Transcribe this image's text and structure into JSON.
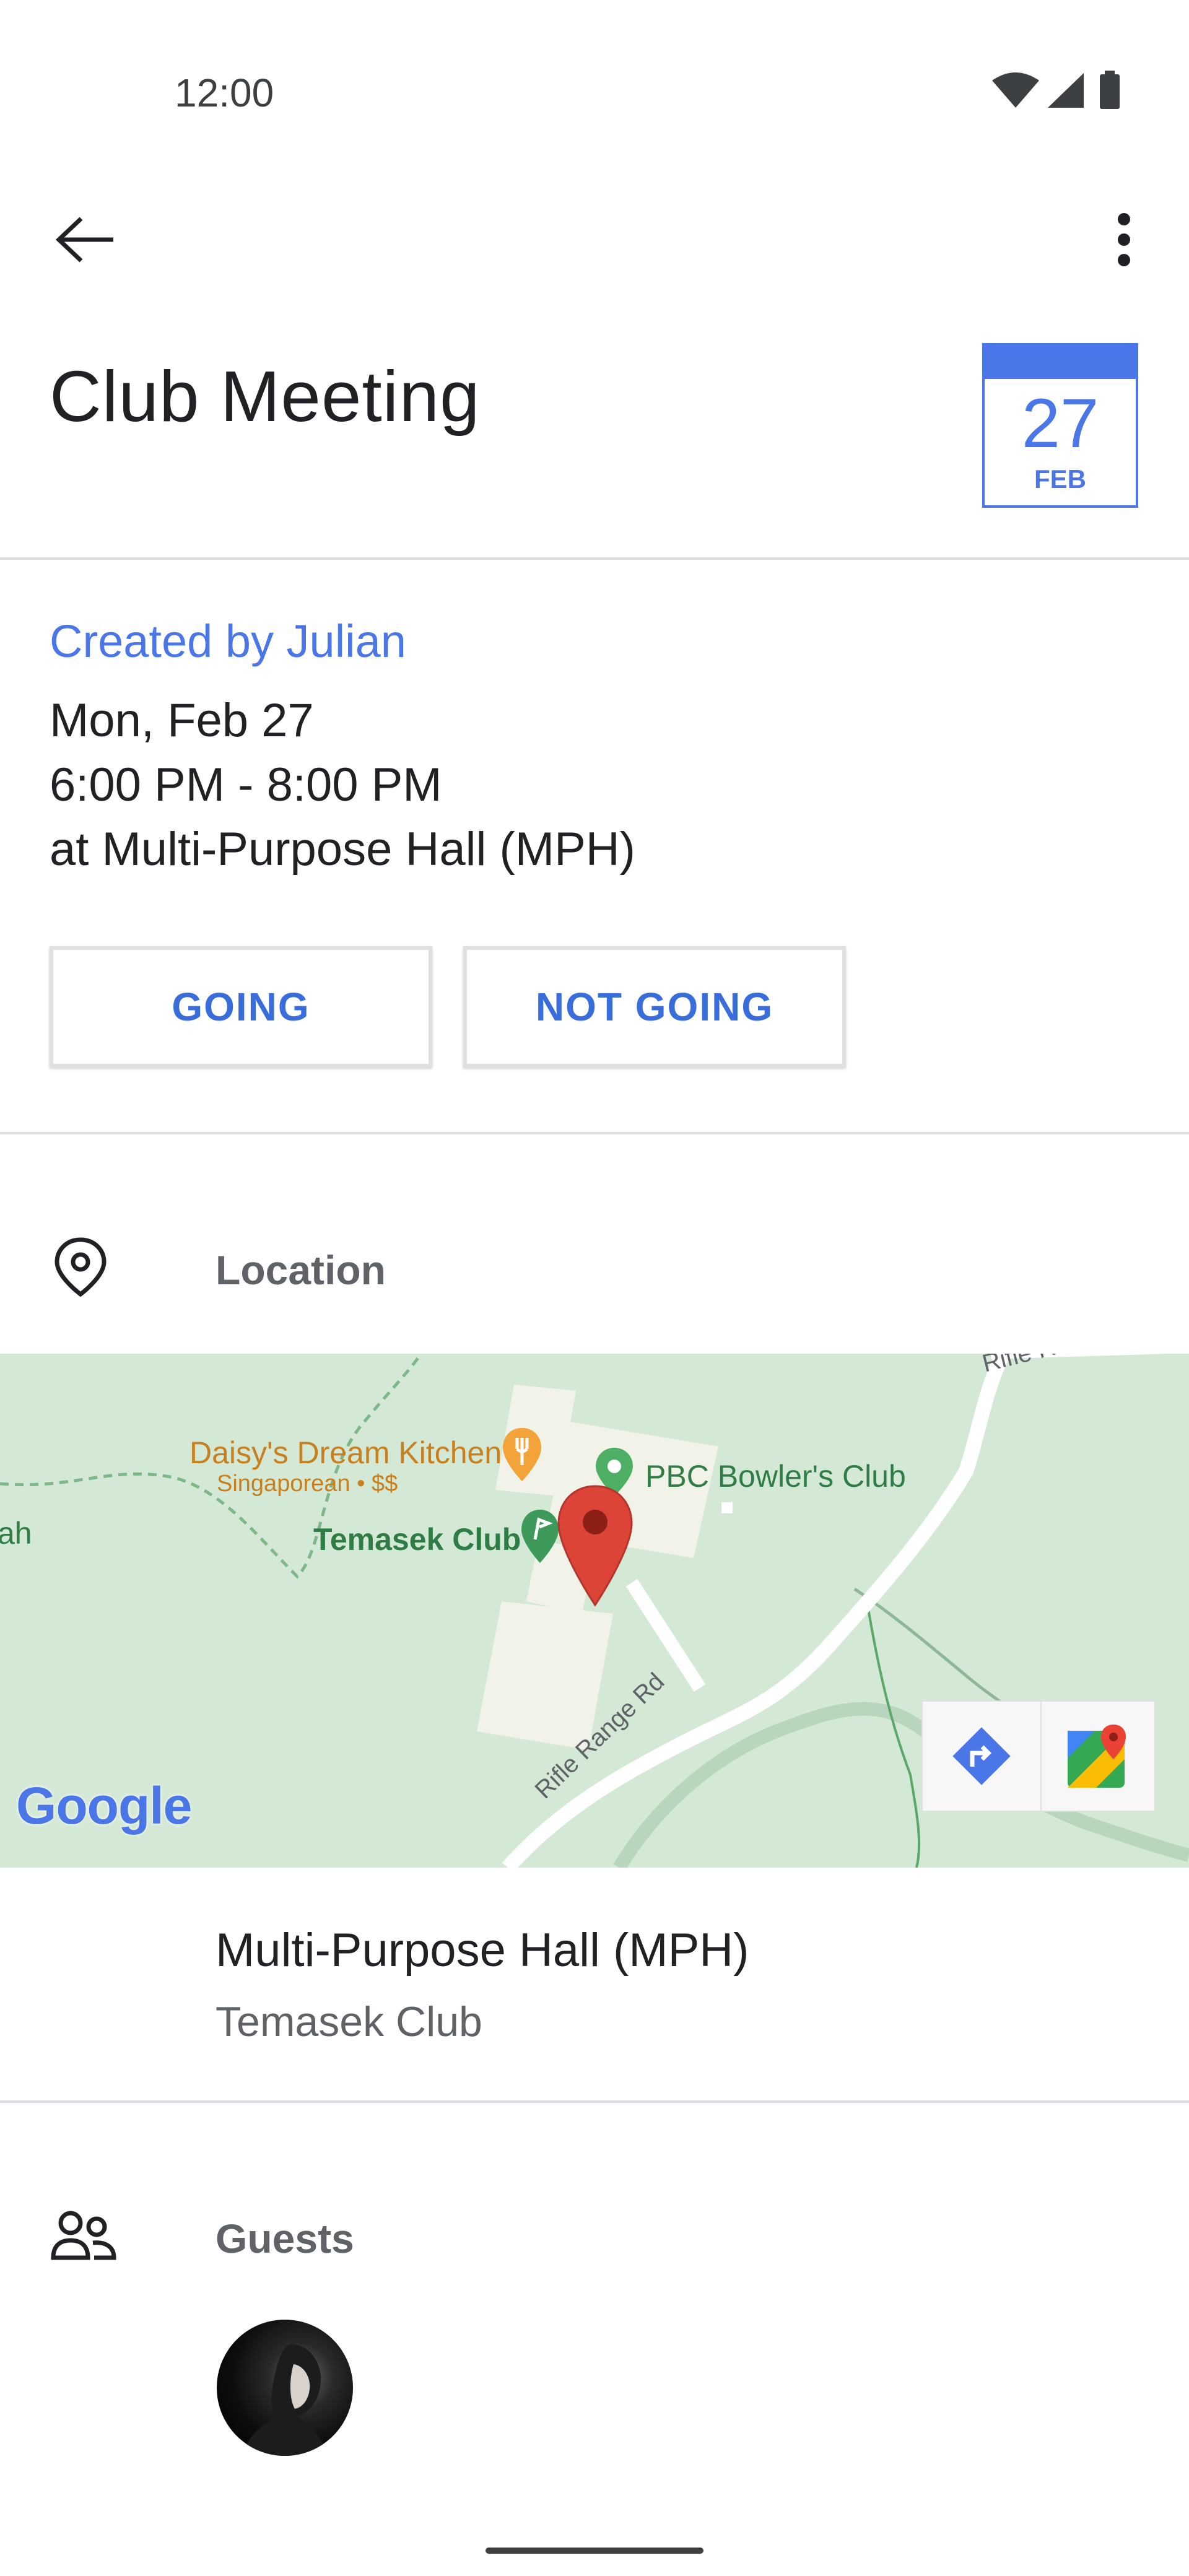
{
  "status_bar": {
    "time": "12:00"
  },
  "app_bar": {
    "back_icon": "arrow-left-icon",
    "more_icon": "more-vert-icon"
  },
  "event": {
    "title": "Club Meeting",
    "date_badge": {
      "day": "27",
      "month": "FEB"
    },
    "created_by": "Created by Julian",
    "date": "Mon, Feb 27",
    "time": "6:00 PM - 8:00 PM",
    "place": "at Multi-Purpose Hall (MPH)"
  },
  "rsvp": {
    "going_label": "GOING",
    "not_going_label": "NOT GOING"
  },
  "location_section": {
    "icon": "location-pin-icon",
    "label": "Location",
    "name": "Multi-Purpose Hall (MPH)",
    "subtitle": "Temasek Club"
  },
  "map": {
    "labels": {
      "daisy": "Daisy's Dream Kitchen",
      "daisy_sub": "Singaporean • $$",
      "pbc": "PBC Bowler's Club",
      "temasek": "Temasek Club",
      "road": "Rifle Range Rd",
      "road_top": "Rifle R",
      "edge": "ah"
    },
    "google_logo": "Google",
    "buttons": {
      "directions_icon": "directions-icon",
      "maps_icon": "google-maps-icon"
    }
  },
  "guests_section": {
    "icon": "people-icon",
    "label": "Guests"
  },
  "colors": {
    "accent": "#4a76e8",
    "button_text": "#3a6ddc",
    "map_bg": "#d4e8d6",
    "pin": "#db4437"
  }
}
